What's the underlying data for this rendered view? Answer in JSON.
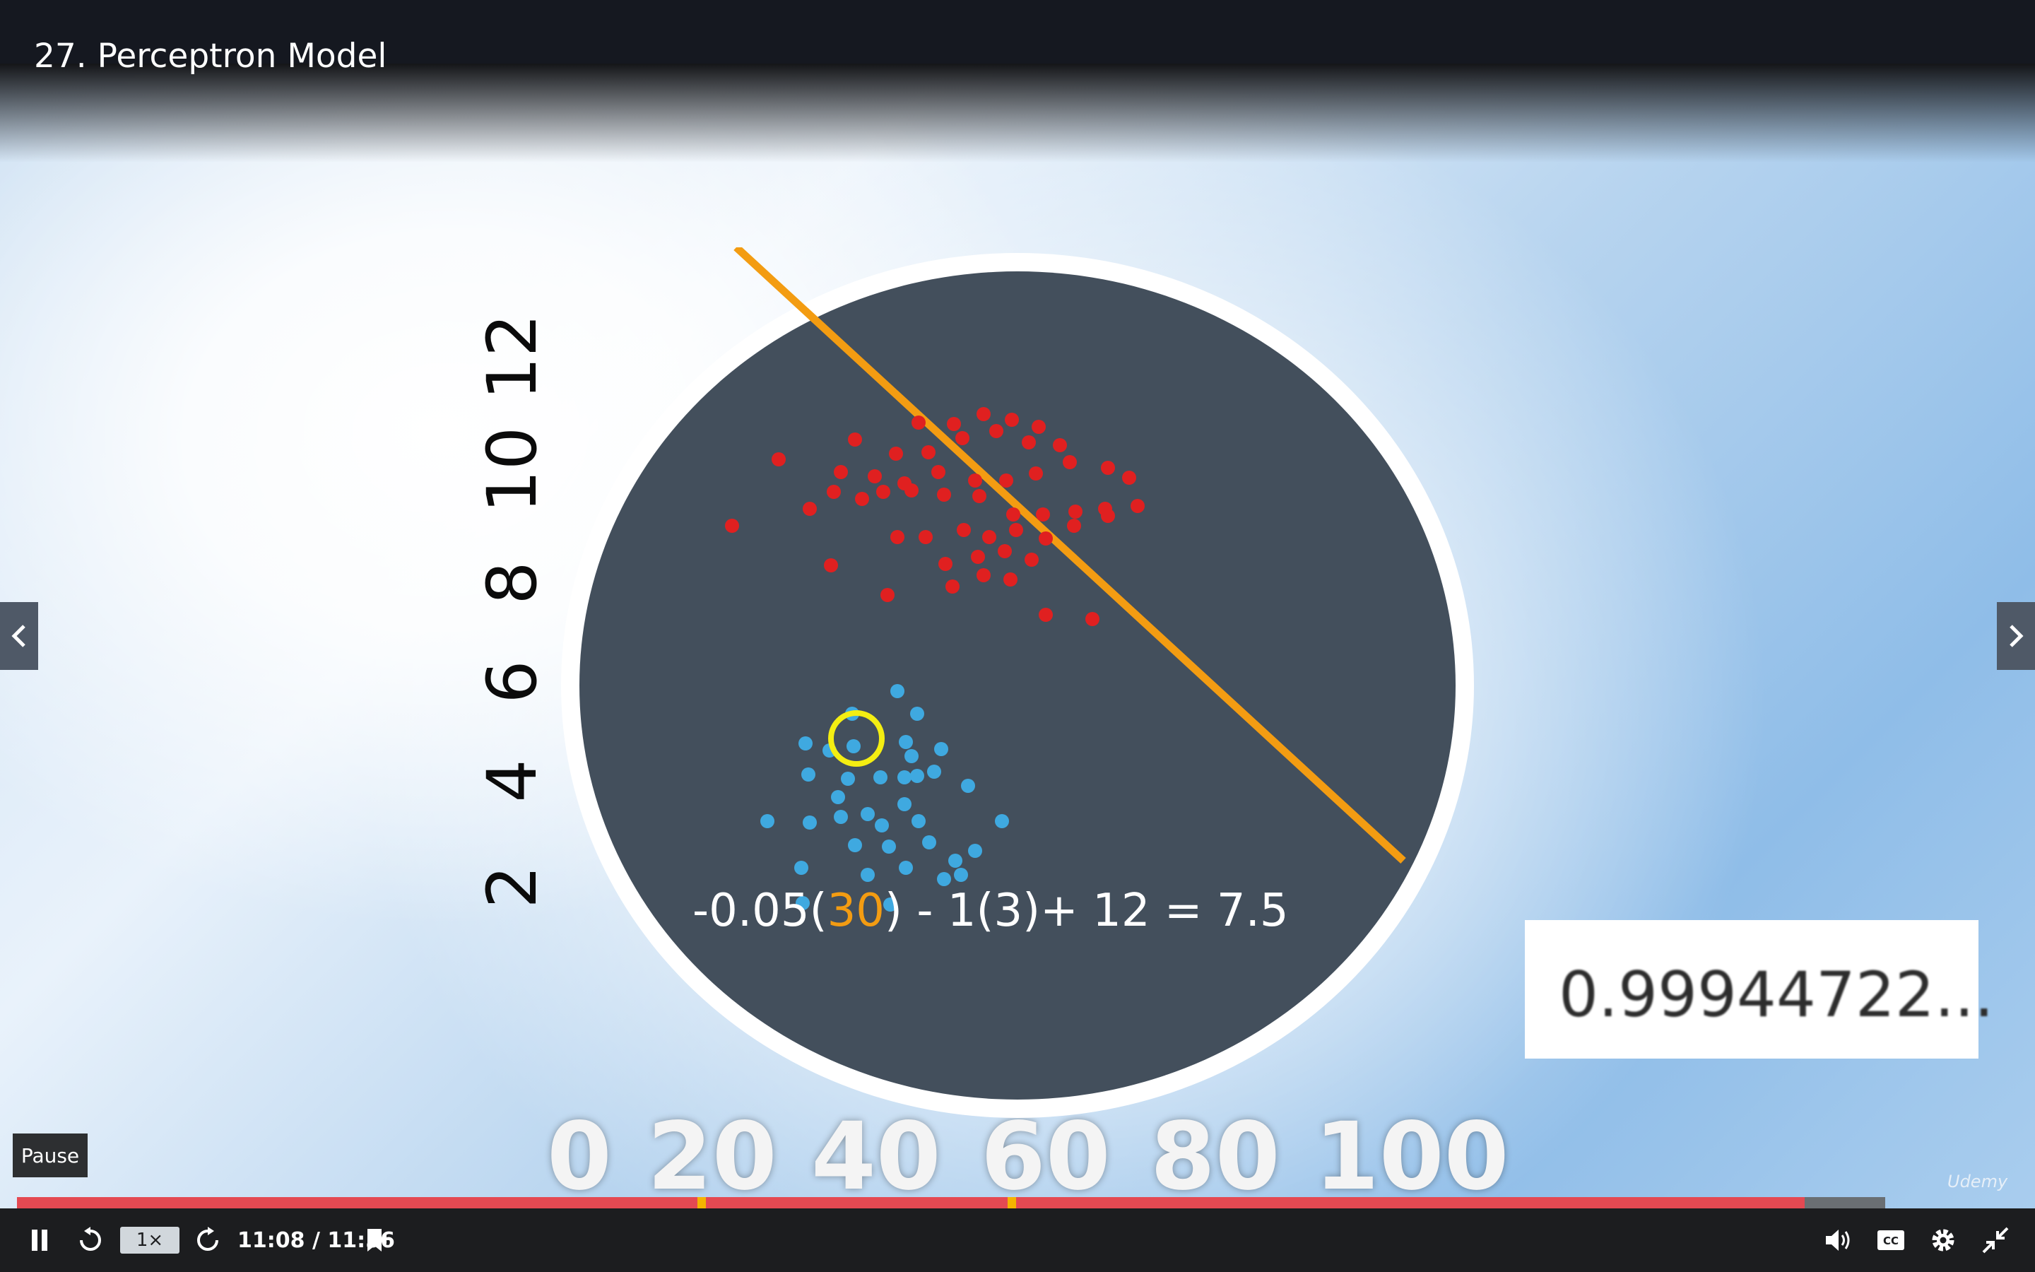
{
  "lecture": {
    "title": "27. Perceptron Model"
  },
  "plot": {
    "y_ticks": [
      "2",
      "4",
      "6",
      "8",
      "10",
      "12"
    ],
    "x_ticks": [
      "0",
      "20",
      "40",
      "60",
      "80",
      "100"
    ],
    "equation": {
      "prefix": "-0.05(",
      "highlight": "30",
      "suffix": ") - 1(3)+ 12 =  7.5"
    },
    "sigmoid_value": "0.99944722...",
    "colors": {
      "circle": "#434f5c",
      "line": "#f39c12",
      "red_points": "#e02020",
      "blue_points": "#3fa9e0",
      "highlight_ring": "#f4ee12"
    }
  },
  "player": {
    "tooltip": "Pause",
    "speed": "1×",
    "time": "11:08 / 11:56",
    "progress_fraction": 0.957,
    "watermark": "Udemy",
    "icons": [
      "pause-icon",
      "rewind-icon",
      "forward-icon",
      "add-note-icon",
      "volume-icon",
      "captions-icon",
      "settings-icon",
      "exit-fullscreen-icon"
    ],
    "nav": {
      "prev_icon": "chevron-left-icon",
      "next_icon": "chevron-right-icon"
    }
  }
}
